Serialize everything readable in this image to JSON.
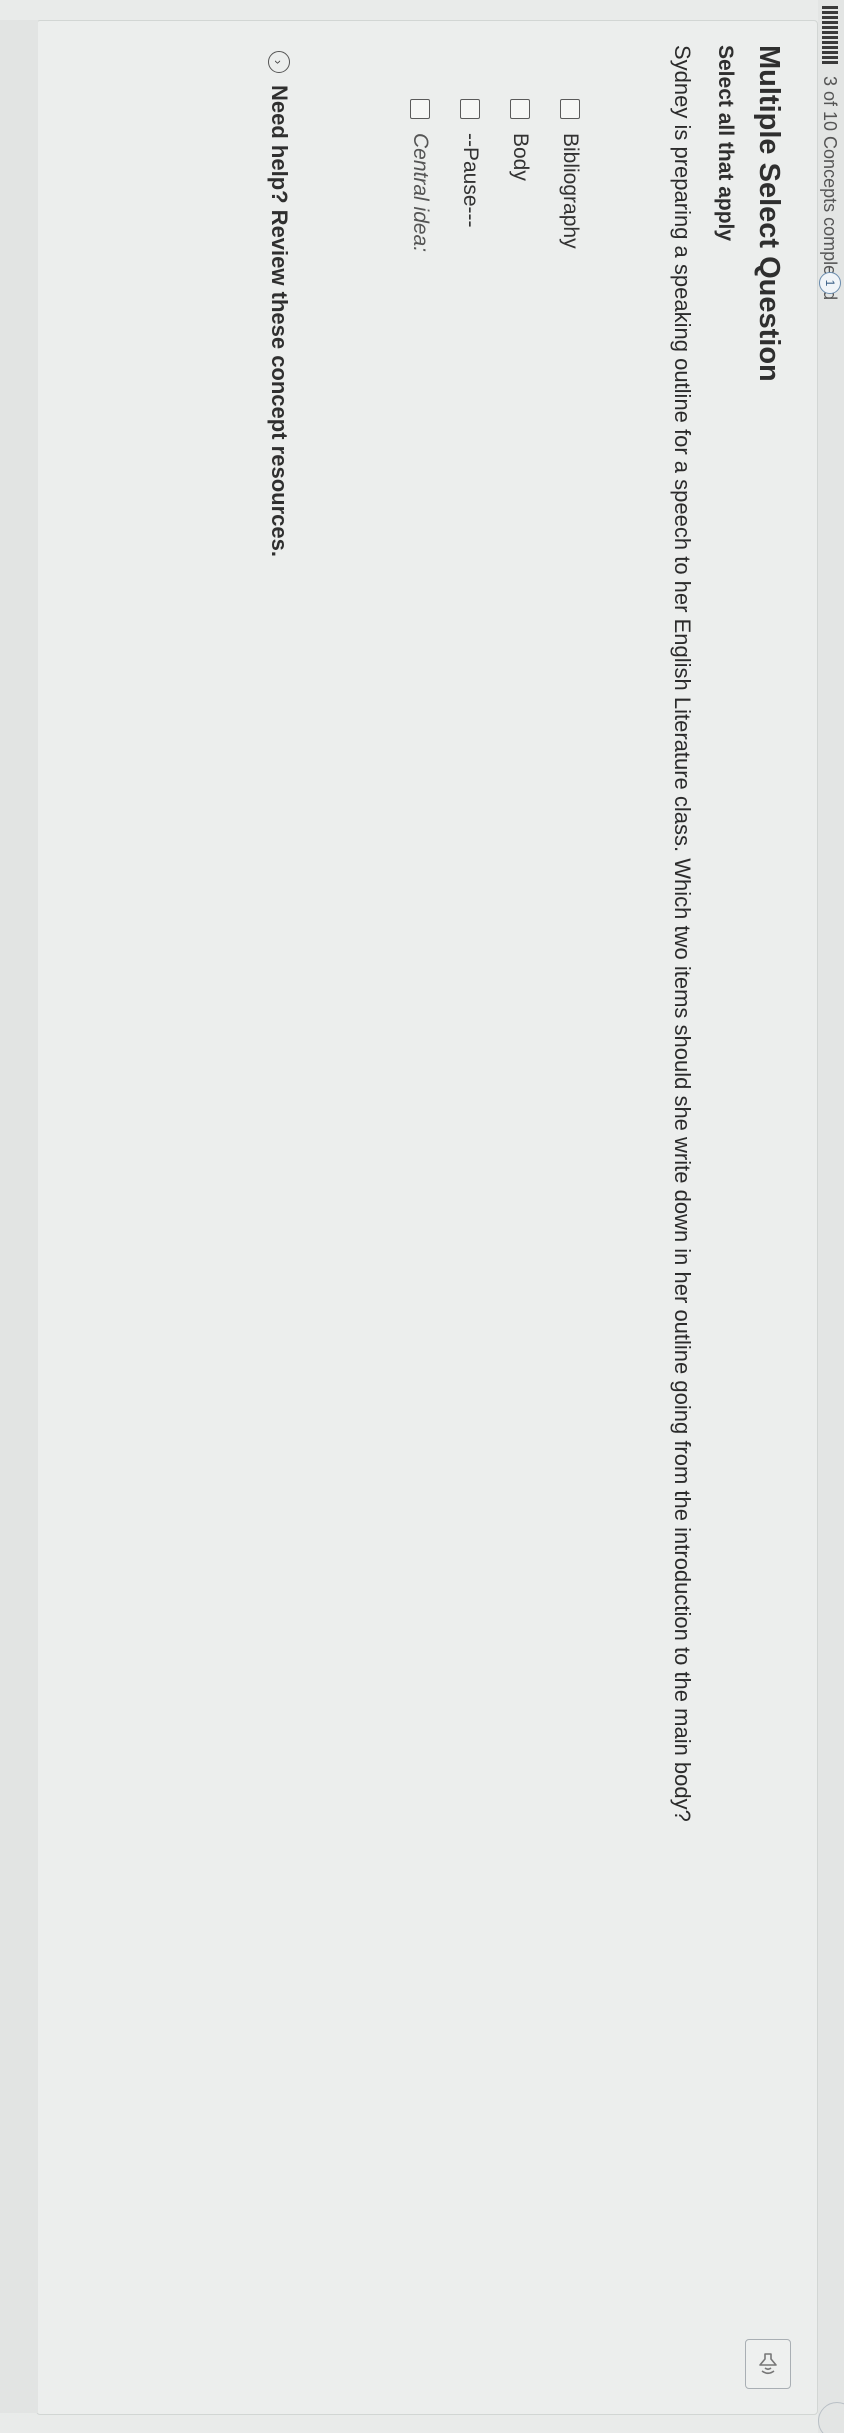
{
  "progress": {
    "text": "3 of 10 Concepts completed",
    "badge": "1"
  },
  "question": {
    "type_title": "Multiple Select Question",
    "instruction": "Select all that apply",
    "text": "Sydney is preparing a speaking outline for a speech to her English Literature class. Which two items should she write down in her outline going from the introduction to the main body?"
  },
  "options": [
    {
      "label": "Bibliography",
      "checked": false
    },
    {
      "label": "Body",
      "checked": false
    },
    {
      "label": "--Pause---",
      "checked": false
    },
    {
      "label": "Central idea:",
      "checked": false
    }
  ],
  "help": {
    "text": "Need help? Review these concept resources."
  },
  "icons": {
    "audio": "speaker-icon",
    "help": "chevron-circle-icon"
  }
}
